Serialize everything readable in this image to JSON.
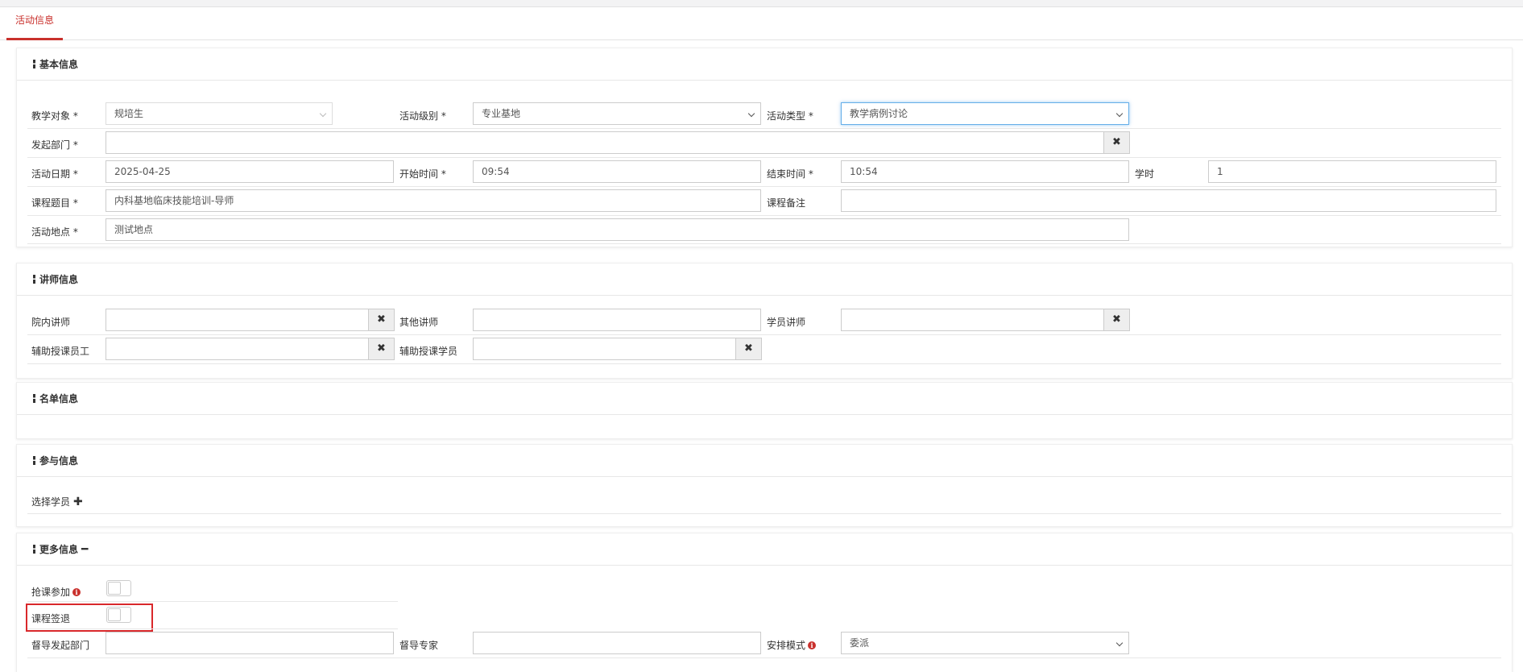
{
  "tabs": [
    {
      "label": "活动信息"
    }
  ],
  "sections": {
    "basic": {
      "title": "基本信息"
    },
    "lecturer": {
      "title": "讲师信息"
    },
    "roster": {
      "title": "名单信息"
    },
    "participation": {
      "title": "参与信息"
    },
    "more": {
      "title": "更多信息"
    }
  },
  "basic": {
    "target_label": "教学对象 *",
    "target_value": "规培生",
    "level_label": "活动级别 *",
    "level_value": "专业基地",
    "type_label": "活动类型 *",
    "type_value": "教学病例讨论",
    "dept_label": "发起部门 *",
    "dept_value": "",
    "date_label": "活动日期 *",
    "date_value": "2025-04-25",
    "start_label": "开始时间 *",
    "start_value": "09:54",
    "end_label": "结束时间 *",
    "end_value": "10:54",
    "hours_label": "学时",
    "hours_value": "1",
    "course_label": "课程题目 *",
    "course_value": "内科基地临床技能培训-导师",
    "note_label": "课程备注",
    "note_value": "",
    "location_label": "活动地点 *",
    "location_value": "测试地点"
  },
  "lecturer": {
    "internal_label": "院内讲师",
    "other_label": "其他讲师",
    "student_label": "学员讲师",
    "assist_staff_label": "辅助授课员工",
    "assist_student_label": "辅助授课学员"
  },
  "participation": {
    "select_label": "选择学员"
  },
  "more": {
    "grab_label": "抢课参加",
    "signout_label": "课程签退",
    "sup_dept_label": "督导发起部门",
    "sup_expert_label": "督导专家",
    "mode_label": "安排模式",
    "mode_value": "委派"
  },
  "icons": {
    "clear": "✖",
    "info": "i",
    "plus": "✚",
    "minus": "━"
  },
  "colors": {
    "accent": "#c9302c",
    "focus": "#66afe9",
    "highlight": "#d9282b"
  }
}
